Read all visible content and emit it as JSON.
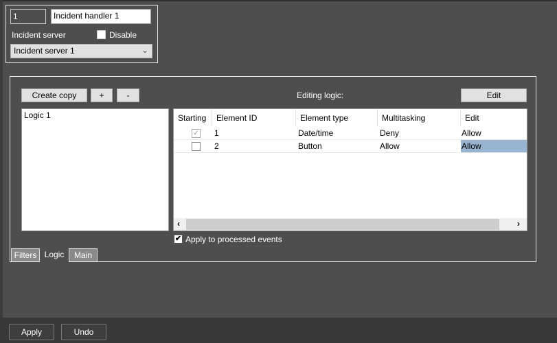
{
  "header": {
    "id_value": "1",
    "name_value": "Incident handler 1",
    "server_label": "Incident server",
    "disable_label": "Disable",
    "disable_checked": false,
    "server_selected": "Incident server 1"
  },
  "toolbar": {
    "create_copy": "Create copy",
    "add": "+",
    "remove": "-",
    "editing_logic_label": "Editing logic:",
    "edit": "Edit"
  },
  "logic_list": [
    "Logic 1"
  ],
  "table": {
    "columns": [
      "Starting",
      "Element ID",
      "Element type",
      "Multitasking",
      "Edit"
    ],
    "rows": [
      {
        "starting": true,
        "id": "1",
        "type": "Date/time",
        "multitasking": "Deny",
        "edit": "Allow"
      },
      {
        "starting": false,
        "id": "2",
        "type": "Button",
        "multitasking": "Allow",
        "edit": "Allow"
      }
    ]
  },
  "apply_processed": {
    "label": "Apply to processed events",
    "checked": true
  },
  "tabs": [
    "Filters",
    "Logic",
    "Main"
  ],
  "footer": {
    "apply": "Apply",
    "undo": "Undo"
  },
  "colors": {
    "selected_cell": "#99b4d1"
  }
}
